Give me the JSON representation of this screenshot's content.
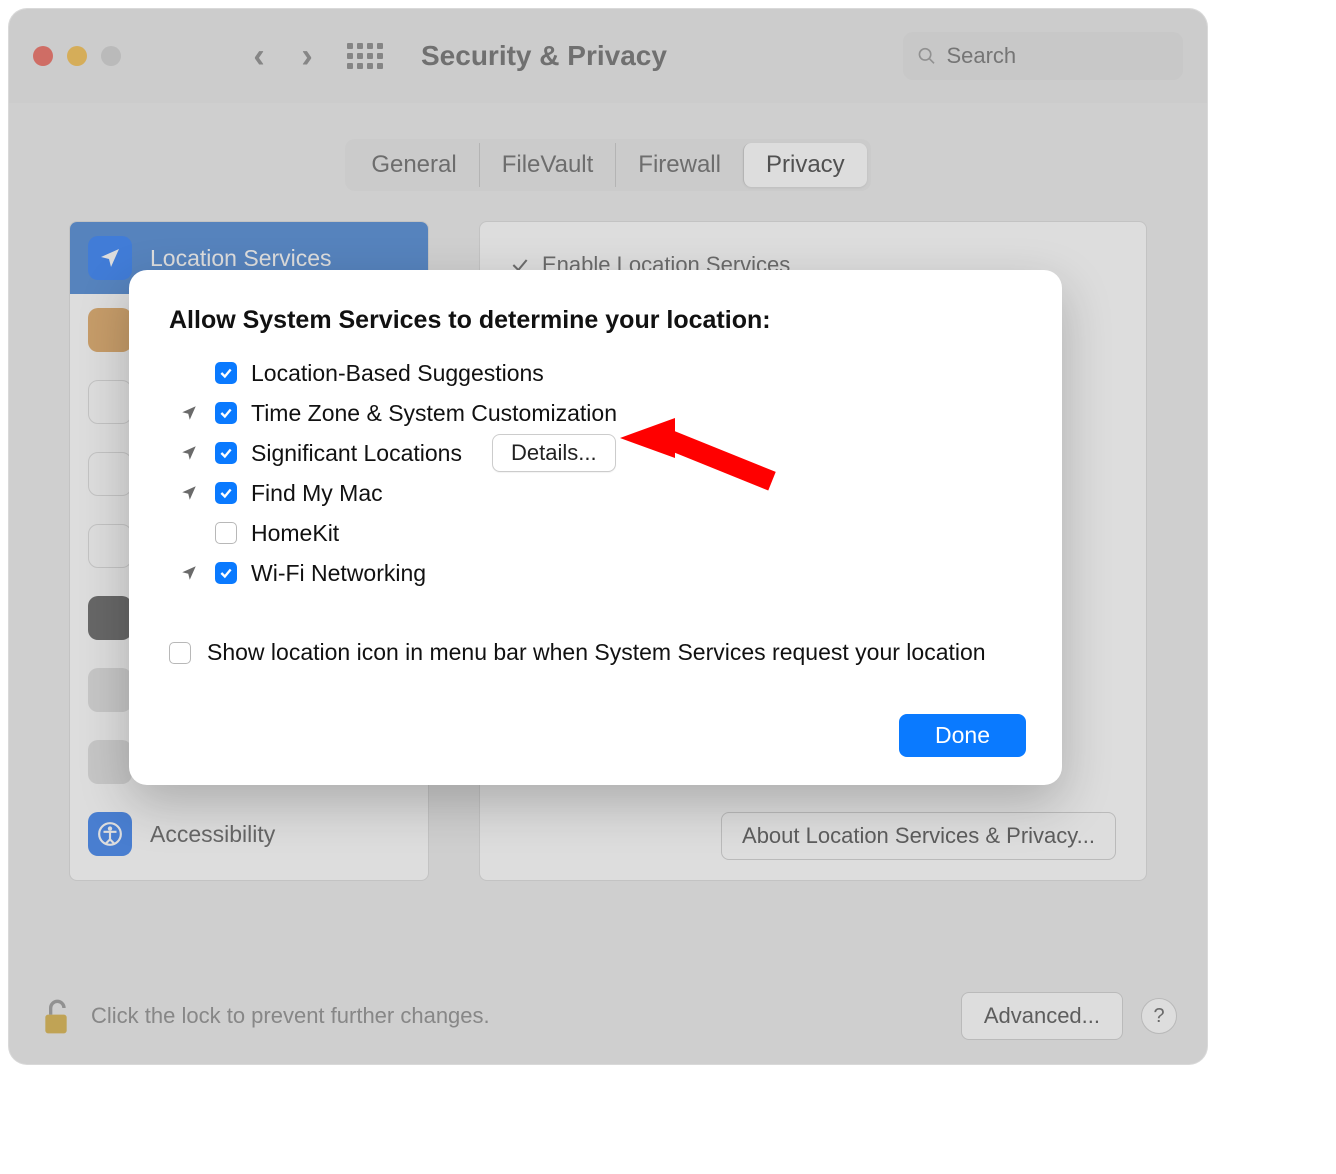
{
  "window": {
    "title": "Security & Privacy",
    "search_placeholder": "Search"
  },
  "tabs": {
    "general": "General",
    "filevault": "FileVault",
    "firewall": "Firewall",
    "privacy": "Privacy",
    "active": "privacy"
  },
  "sidebar": {
    "location_services": "Location Services",
    "accessibility": "Accessibility"
  },
  "main": {
    "enable_label": "Enable Location Services",
    "about_button": "About Location Services & Privacy..."
  },
  "footer": {
    "lock_text": "Click the lock to prevent further changes.",
    "advanced": "Advanced...",
    "help": "?"
  },
  "modal": {
    "heading": "Allow System Services to determine your location:",
    "services": [
      {
        "label": "Location-Based Suggestions",
        "checked": true,
        "recent": false
      },
      {
        "label": "Time Zone & System Customization",
        "checked": true,
        "recent": true
      },
      {
        "label": "Significant Locations",
        "checked": true,
        "recent": true,
        "has_details": true
      },
      {
        "label": "Find My Mac",
        "checked": true,
        "recent": true
      },
      {
        "label": "HomeKit",
        "checked": false,
        "recent": false
      },
      {
        "label": "Wi-Fi Networking",
        "checked": true,
        "recent": true
      }
    ],
    "details_button": "Details...",
    "show_icon_label": "Show location icon in menu bar when System Services request your location",
    "show_icon_checked": false,
    "done_button": "Done"
  }
}
